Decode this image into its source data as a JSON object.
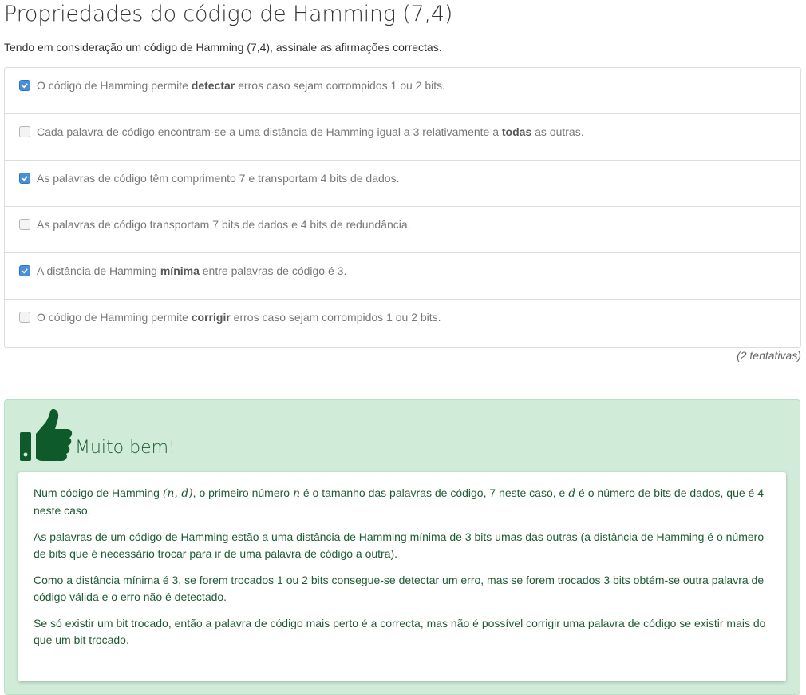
{
  "question": {
    "title": "Propriedades do código de Hamming (7,4)",
    "instructions": "Tendo em consideração um código de Hamming (7,4), assinale as afirmações correctas.",
    "options": [
      {
        "checked": true,
        "pre": "O código de Hamming permite ",
        "bold": "detectar",
        "post": " erros caso sejam corrompidos 1 ou 2 bits."
      },
      {
        "checked": false,
        "pre": "Cada palavra de código encontram-se a uma distância de Hamming igual a 3 relativamente a ",
        "bold": "todas",
        "post": " as outras."
      },
      {
        "checked": true,
        "pre": "As palavras de código têm comprimento 7 e transportam 4 bits de dados.",
        "bold": "",
        "post": ""
      },
      {
        "checked": false,
        "pre": "As palavras de código transportam 7 bits de dados e 4 bits de redundância.",
        "bold": "",
        "post": ""
      },
      {
        "checked": true,
        "pre": "A distância de Hamming ",
        "bold": "mínima",
        "post": " entre palavras de código é 3."
      },
      {
        "checked": false,
        "pre": "O código de Hamming permite ",
        "bold": "corrigir",
        "post": " erros caso sejam corrompidos 1 ou 2 bits."
      }
    ],
    "attempts": "(2 tentativas)"
  },
  "feedback": {
    "icon": "thumbs-up-icon",
    "heading": "Muito bem!",
    "color": "#1e5b33",
    "background": "#d0ecd9",
    "p1": {
      "a": "Num código de Hamming ",
      "math1": "(n, d)",
      "b": ", o primeiro número ",
      "math2": "n",
      "c": " é o tamanho das palavras de código, 7 neste caso, e ",
      "math3": "d",
      "d": " é o número de bits de dados, que é 4 neste caso."
    },
    "p2": "As palavras de um código de Hamming estão a uma distância de Hamming mínima de 3 bits umas das outras (a distância de Hamming é o número de bits que é necessário trocar para ir de uma palavra de código a outra).",
    "p3": "Como a distância mínima é 3, se forem trocados 1 ou 2 bits consegue-se detectar um erro, mas se forem trocados 3 bits obtém-se outra palavra de código válida e o erro não é detectado.",
    "p4": "Se só existir um bit trocado, então a palavra de código mais perto é a correcta, mas não é possível corrigir uma palavra de código se existir mais do que um bit trocado."
  }
}
